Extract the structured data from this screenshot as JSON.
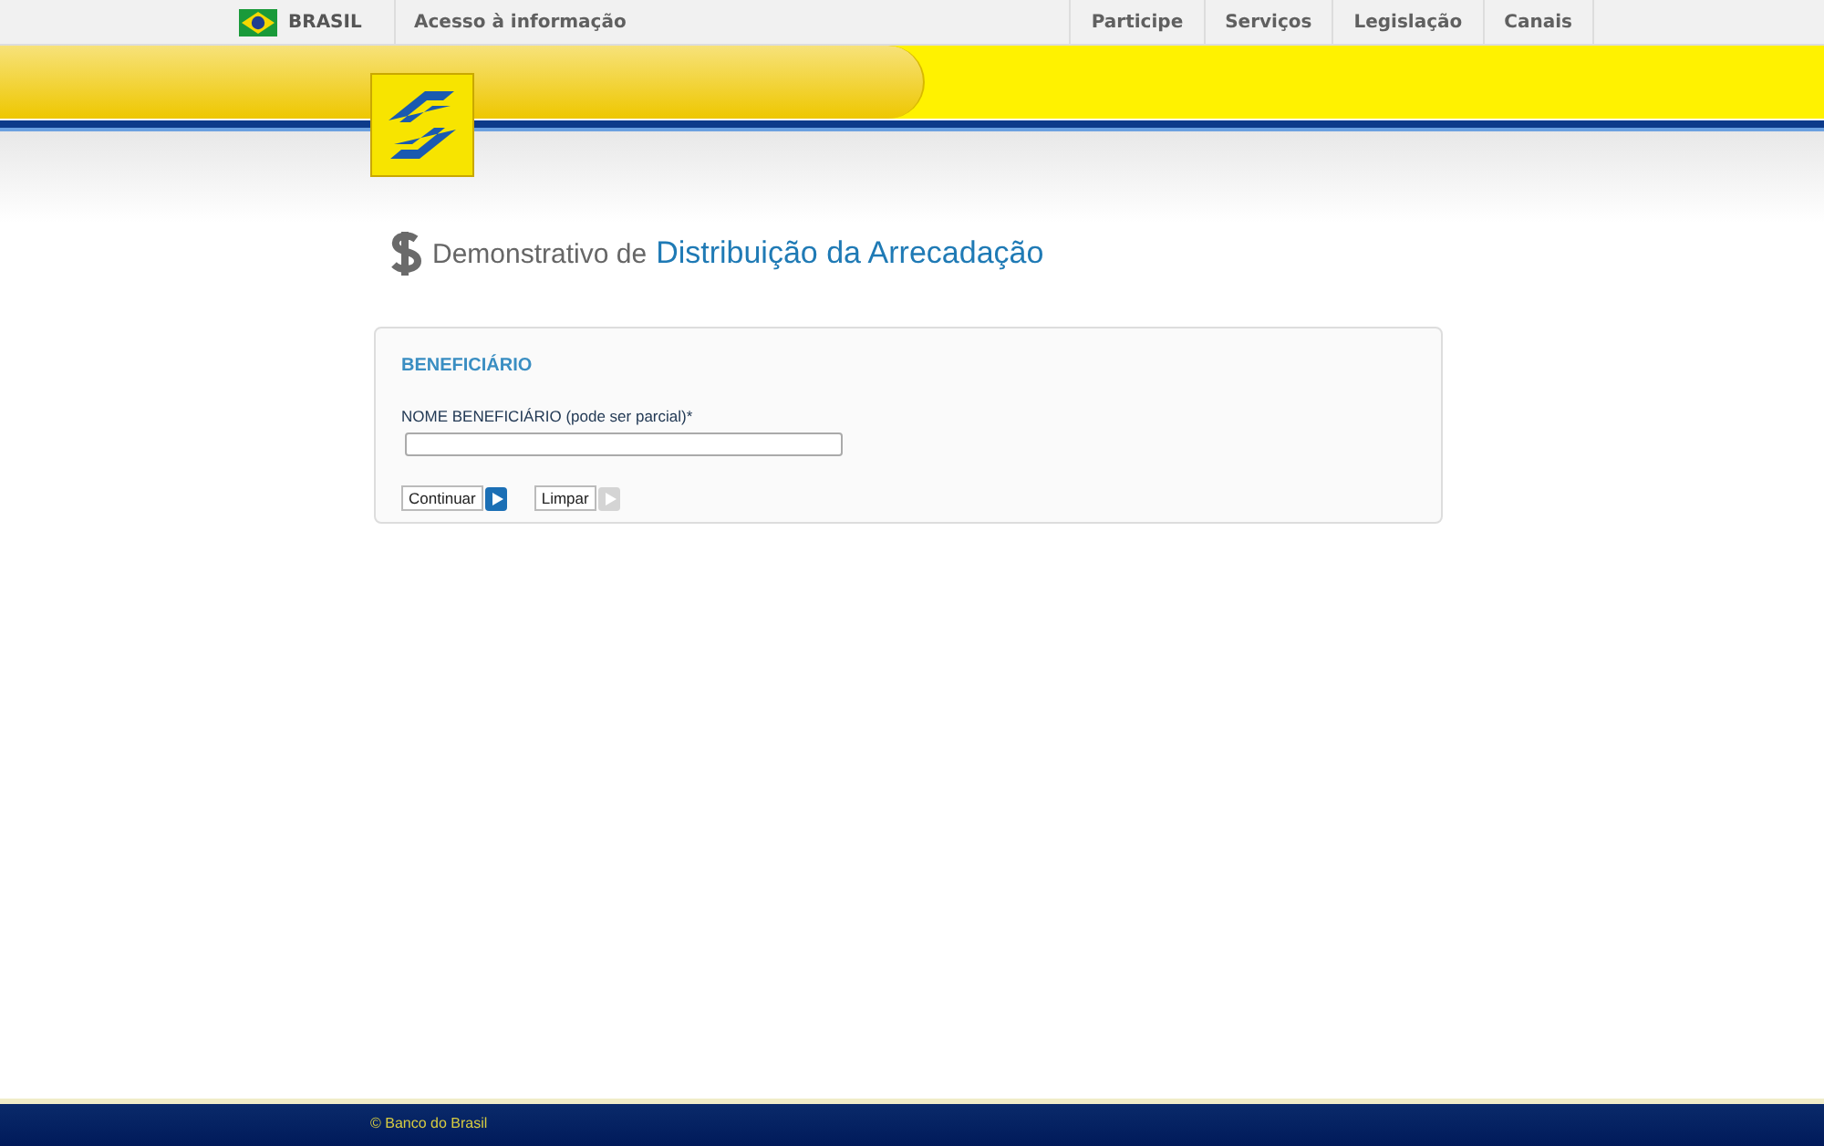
{
  "gov_bar": {
    "country": "BRASIL",
    "access_link": "Acesso à informação",
    "links": [
      "Participe",
      "Serviços",
      "Legislação",
      "Canais"
    ]
  },
  "page_title": {
    "prefix": "Demonstrativo de",
    "main": "Distribuição da Arrecadação"
  },
  "form": {
    "section_title": "BENEFICIÁRIO",
    "field_label": "NOME BENEFICIÁRIO (pode ser parcial)*",
    "buttons": [
      {
        "label": "Continuar",
        "disabled": false
      },
      {
        "label": "Limpar",
        "disabled": true
      }
    ]
  },
  "footer": {
    "copyright": "© Banco do Brasil"
  }
}
